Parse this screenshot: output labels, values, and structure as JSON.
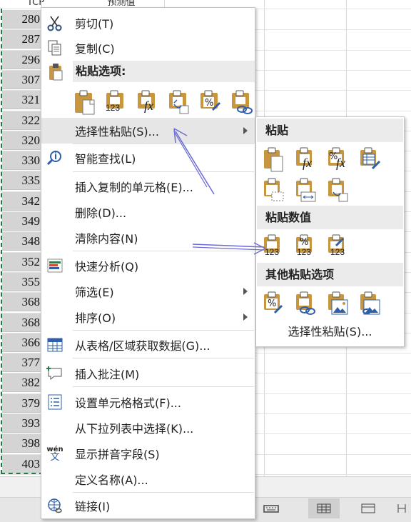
{
  "sheet": {
    "col_header_a": "TCP",
    "col_header_b": "预测值",
    "row_values": [
      "280",
      "287",
      "296",
      "307",
      "321",
      "322",
      "320",
      "330",
      "335",
      "342",
      "349",
      "348",
      "352",
      "355",
      "368",
      "368",
      "366",
      "377",
      "382",
      "379",
      "393",
      "398",
      "403"
    ]
  },
  "menu": {
    "cut": "剪切(T)",
    "copy": "复制(C)",
    "paste_options": "粘贴选项:",
    "paste_special": "选择性粘贴(S)...",
    "smart_lookup": "智能查找(L)",
    "insert_copied": "插入复制的单元格(E)...",
    "delete": "删除(D)...",
    "clear": "清除内容(N)",
    "quick_analysis": "快速分析(Q)",
    "filter": "筛选(E)",
    "sort": "排序(O)",
    "get_data": "从表格/区域获取数据(G)...",
    "insert_comment": "插入批注(M)",
    "format_cells": "设置单元格格式(F)...",
    "pick_list": "从下拉列表中选择(K)...",
    "phonetic": "显示拼音字段(S)",
    "define_name": "定义名称(A)...",
    "link": "链接(I)",
    "phonetic_icon_text": "wén",
    "phonetic_icon_char": "文"
  },
  "submenu": {
    "paste": "粘贴",
    "paste_values": "粘贴数值",
    "other_paste": "其他粘贴选项",
    "paste_special": "选择性粘贴(S)..."
  },
  "icon_text": {
    "n123": "123",
    "fx": "fx",
    "pct": "%"
  },
  "colors": {
    "clipboard": "#c8963e",
    "paper": "#ffffff",
    "accent_blue": "#2e5fa8",
    "arrow": "#6b6bd6",
    "green_border": "#1e7a44"
  }
}
